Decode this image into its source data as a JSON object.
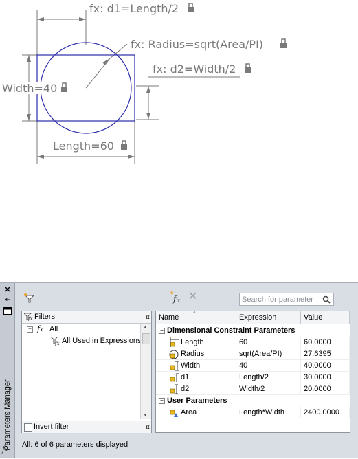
{
  "drawing": {
    "d1_label": "fx: d1=Length/2",
    "radius_label": "fx: Radius=sqrt(Area/PI)",
    "d2_label": "fx: d2=Width/2",
    "width_label": "Width=40",
    "length_label": "Length=60",
    "line_color": "#7a7a7a",
    "geometry_color": "#2a2aa8"
  },
  "palette": {
    "title": "Parameters Manager",
    "fx_icon": "fx-icon",
    "search": {
      "placeholder": "Search for parameter"
    },
    "filters": {
      "header": "Filters",
      "tree": [
        {
          "label": "All",
          "icon": "fx-icon"
        },
        {
          "label": "All Used in Expressions",
          "icon": "filter-fx-icon"
        }
      ],
      "invert_label": "Invert filter"
    },
    "grid": {
      "columns": [
        "Name",
        "Expression",
        "Value"
      ],
      "groups": [
        {
          "label": "Dimensional Constraint Parameters",
          "rows": [
            {
              "name": "Length",
              "expression": "60",
              "value": "60.0000",
              "icon": "linear-constraint-icon"
            },
            {
              "name": "Radius",
              "expression": "sqrt(Area/PI)",
              "value": "27.6395",
              "icon": "radial-constraint-icon"
            },
            {
              "name": "Width",
              "expression": "40",
              "value": "40.0000",
              "icon": "vertical-constraint-icon"
            },
            {
              "name": "d1",
              "expression": "Length/2",
              "value": "30.0000",
              "icon": "horizontal-constraint-icon"
            },
            {
              "name": "d2",
              "expression": "Width/2",
              "value": "20.0000",
              "icon": "vertical-constraint-icon"
            }
          ]
        },
        {
          "label": "User Parameters",
          "rows": [
            {
              "name": "Area",
              "expression": "Length*Width",
              "value": "2400.0000",
              "icon": "user-parameter-icon"
            }
          ]
        }
      ]
    },
    "status": "All: 6 of 6 parameters displayed"
  }
}
